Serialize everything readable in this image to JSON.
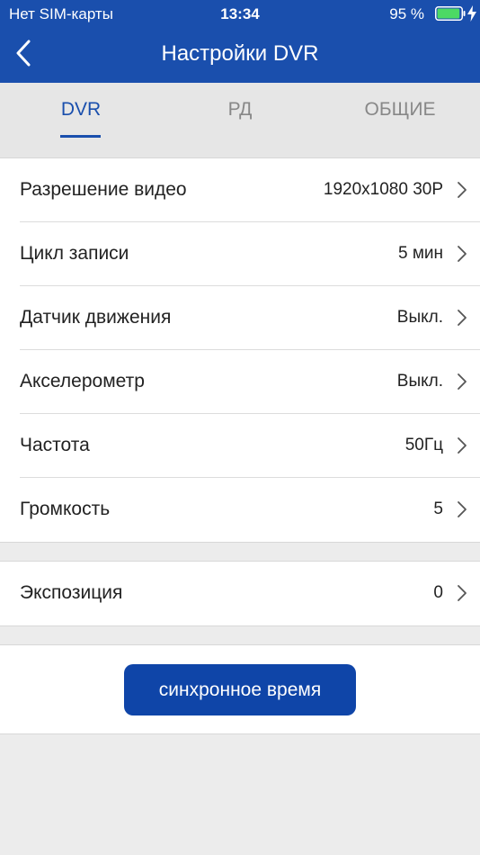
{
  "status_bar": {
    "carrier": "Нет SIM-карты",
    "time": "13:34",
    "battery_percent": "95 %",
    "battery_level": 0.95,
    "battery_color": "#4cd964"
  },
  "nav": {
    "title": "Настройки DVR",
    "back_icon": "chevron-left-icon"
  },
  "tabs": [
    {
      "label": "DVR",
      "active": true
    },
    {
      "label": "РД",
      "active": false
    },
    {
      "label": "ОБЩИЕ",
      "active": false
    }
  ],
  "settings_group1": [
    {
      "label": "Разрешение видео",
      "value": "1920x1080 30P"
    },
    {
      "label": "Цикл записи",
      "value": "5 мин"
    },
    {
      "label": "Датчик движения",
      "value": "Выкл."
    },
    {
      "label": "Акселерометр",
      "value": "Выкл."
    },
    {
      "label": "Частота",
      "value": "50Гц"
    },
    {
      "label": "Громкость",
      "value": "5"
    }
  ],
  "settings_group2": [
    {
      "label": "Экспозиция",
      "value": "0"
    }
  ],
  "sync_button": {
    "label": "синхронное время"
  },
  "colors": {
    "accent": "#1a4fad",
    "button": "#0f45a8",
    "background": "#ececec"
  }
}
